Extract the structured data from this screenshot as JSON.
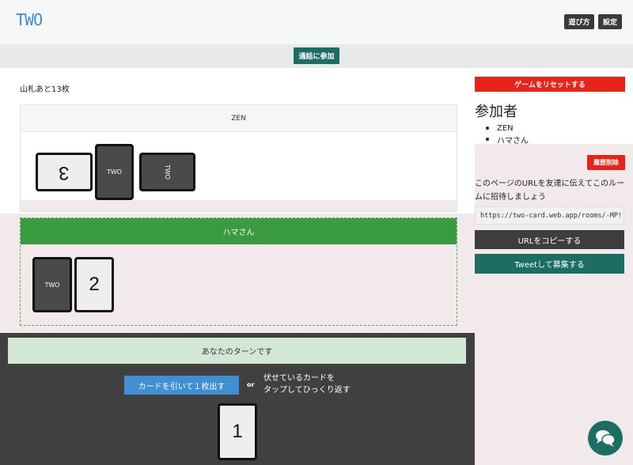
{
  "header": {
    "logo": "TWO",
    "howto_label": "遊び方",
    "settings_label": "設定"
  },
  "call": {
    "join_label": "通話に参加"
  },
  "game": {
    "deck_remaining": "山札あと13枚",
    "players": [
      {
        "name": "ZEN",
        "cards": [
          {
            "face": "3",
            "style": "light",
            "orientation": "upside-down"
          },
          {
            "face": "TWO",
            "style": "dark",
            "orientation": "upright"
          },
          {
            "face": "TWO",
            "style": "dark",
            "orientation": "sideways"
          }
        ]
      },
      {
        "name": "ハマさん",
        "cards": [
          {
            "face": "TWO",
            "style": "dark",
            "orientation": "upright"
          },
          {
            "face": "2",
            "style": "light",
            "orientation": "upright"
          }
        ]
      }
    ],
    "turn_message": "あなたのターンです",
    "draw_button": "カードを引いて１枚出す",
    "or_label": "or",
    "flip_hint_line1": "伏せているカードを",
    "flip_hint_line2": "タップしてひっくり返す",
    "my_card": {
      "face": "1",
      "style": "light",
      "orientation": "upright"
    }
  },
  "sidebar": {
    "reset_label": "ゲームをリセットする",
    "participants_title": "参加者",
    "participants": [
      "ZEN",
      "ハマさん"
    ],
    "clear_history_label": "履歴削除",
    "invite_text": "このページのURLを友達に伝えてこのルームに招待しましょう",
    "room_url": "https://two-card.web.app/rooms/-MP!",
    "copy_url_label": "URLをコピーする",
    "tweet_label": "Tweetして募集する"
  },
  "colors": {
    "accent_blue": "#3f8fd2",
    "accent_teal": "#1c6e64",
    "danger_red": "#e8231a",
    "player_green": "#3a9a3f",
    "turn_bg": "#d3e8d4"
  },
  "icons": {
    "chat": "chat-bubbles-icon"
  }
}
